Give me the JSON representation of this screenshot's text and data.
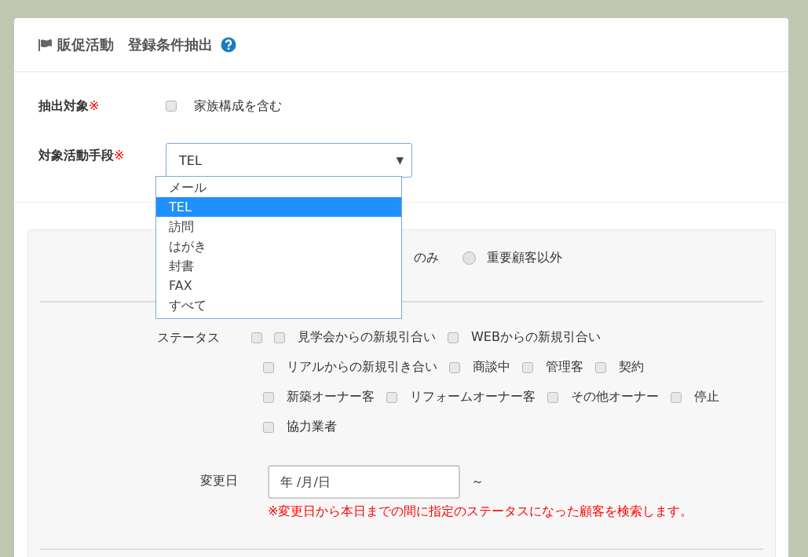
{
  "header": {
    "title": "販促活動　登録条件抽出"
  },
  "form": {
    "target": {
      "label": "抽出対象",
      "required_mark": "※",
      "option": {
        "label": "家族構成を含む",
        "checked": false
      }
    },
    "method": {
      "label": "対象活動手段",
      "required_mark": "※",
      "value": "TEL",
      "caret": "▼",
      "expanded": true,
      "options": [
        {
          "label": "メール",
          "selected": false
        },
        {
          "label": "TEL",
          "selected": true
        },
        {
          "label": "訪問",
          "selected": false
        },
        {
          "label": "はがき",
          "selected": false
        },
        {
          "label": "封書",
          "selected": false
        },
        {
          "label": "FAX",
          "selected": false
        },
        {
          "label": "すべて",
          "selected": false
        }
      ]
    }
  },
  "panel": {
    "customer_filter": [
      {
        "label": "のみ",
        "kind": "partial"
      },
      {
        "label": "重要顧客以外",
        "kind": "radio",
        "selected": false
      }
    ],
    "status": {
      "label": "ステータス",
      "lines": [
        [
          {
            "checked": false
          },
          {
            "label": "見学会からの新規引合い",
            "checked": false
          },
          {
            "label": "WEBからの新規引合い",
            "checked": false
          }
        ],
        [
          {
            "label": "リアルからの新規引き合い",
            "checked": false
          },
          {
            "label": "商談中",
            "checked": false
          },
          {
            "label": "管理客",
            "checked": false
          },
          {
            "label": "契約",
            "checked": false
          }
        ],
        [
          {
            "label": "新築オーナー客",
            "checked": false
          },
          {
            "label": "リフォームオーナー客",
            "checked": false
          },
          {
            "label": "その他オーナー",
            "checked": false
          },
          {
            "label": "停止",
            "checked": false
          }
        ],
        [
          {
            "label": "協力業者",
            "checked": false
          }
        ]
      ]
    },
    "changed_date": {
      "label": "変更日",
      "placeholder": "年 /月/日",
      "separator": "～",
      "note": "※変更日から本日までの間に指定のステータスになった顧客を検索します。"
    }
  }
}
